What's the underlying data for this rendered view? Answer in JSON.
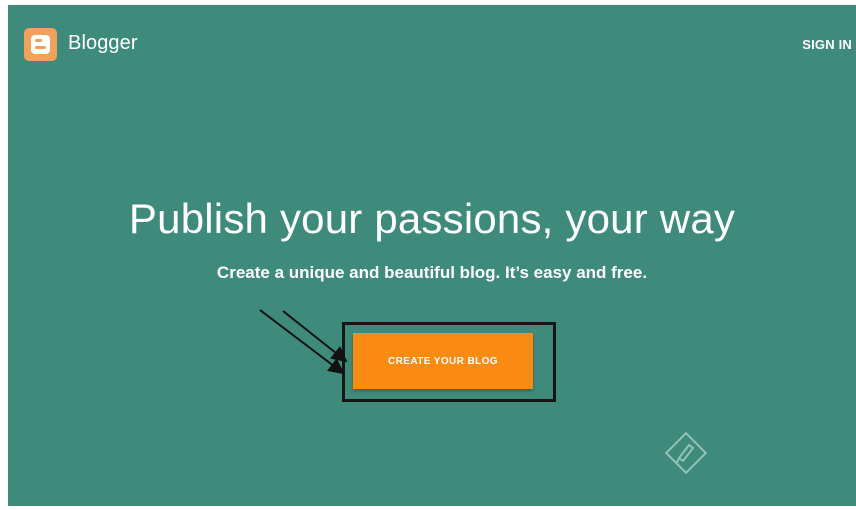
{
  "header": {
    "brand": "Blogger",
    "logo_icon": "blogger-logo-icon",
    "sign_in_label": "SIGN IN"
  },
  "hero": {
    "headline": "Publish your passions, your way",
    "subtitle": "Create a unique and beautiful blog. It’s easy and free.",
    "cta_label": "CREATE YOUR BLOG",
    "background_color": "#3e8a7b",
    "cta_color": "#f98a12"
  },
  "annotation": {
    "arrow_icon": "annotation-arrows-icon",
    "box": "highlight-box"
  },
  "decorations": {
    "corner_icon": "pencil-icon"
  },
  "colors": {
    "logo": "#f0a15b",
    "text": "#ffffff",
    "outline": "#161616"
  }
}
